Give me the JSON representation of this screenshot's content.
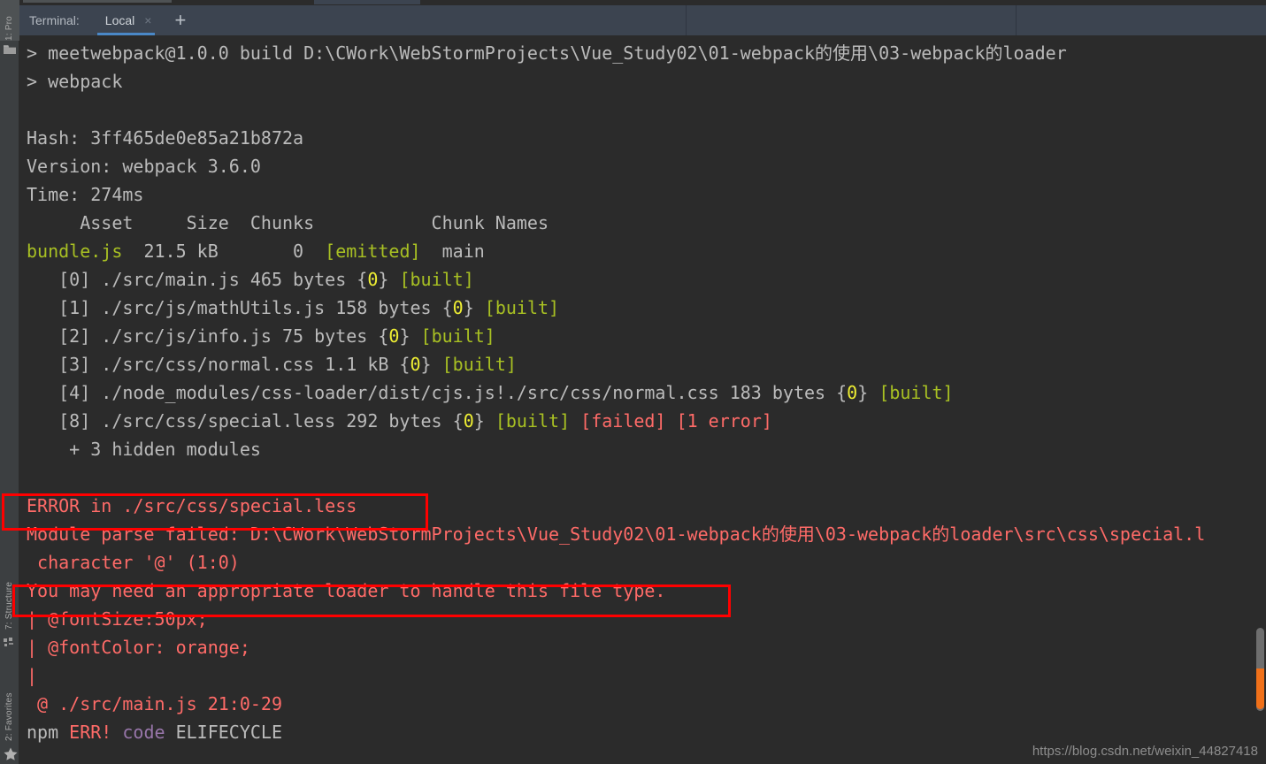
{
  "window": {
    "accent_blue": "#4a88c7",
    "bg": "#2b2b2b",
    "header_bg": "#3c4450",
    "annotation_color": "#ff0000"
  },
  "tool_stripe": {
    "items": [
      {
        "label": "1: Pro",
        "name": "project",
        "icon": "folder-icon"
      },
      {
        "label": "7: Structure",
        "name": "structure",
        "icon": "squares-icon"
      },
      {
        "label": "2: Favorites",
        "name": "favorites",
        "icon": "star-icon"
      }
    ]
  },
  "terminal": {
    "label": "Terminal:",
    "tabs": [
      {
        "label": "Local",
        "close": "×",
        "active": true
      }
    ],
    "new_tab_label": "+"
  },
  "console": {
    "lines": [
      {
        "segs": [
          {
            "t": "> meetwebpack@1.0.0 build D:\\CWork\\WebStormProjects\\Vue_Study02\\01-webpack的使用\\03-webpack的loader",
            "c": "w"
          }
        ]
      },
      {
        "segs": [
          {
            "t": "> webpack",
            "c": "w"
          }
        ]
      },
      {
        "segs": [
          {
            "t": "",
            "c": "w"
          }
        ]
      },
      {
        "segs": [
          {
            "t": "Hash: 3ff465de0e85a21b872a",
            "c": "w"
          }
        ]
      },
      {
        "segs": [
          {
            "t": "Version: webpack 3.6.0",
            "c": "w"
          }
        ]
      },
      {
        "segs": [
          {
            "t": "Time: 274ms",
            "c": "w"
          }
        ]
      },
      {
        "segs": [
          {
            "t": "     Asset     Size  Chunks           Chunk Names",
            "c": "w"
          }
        ]
      },
      {
        "segs": [
          {
            "t": "bundle.js",
            "c": "g"
          },
          {
            "t": "  21.5 kB       0  ",
            "c": "w"
          },
          {
            "t": "[emitted]",
            "c": "g"
          },
          {
            "t": "  main",
            "c": "w"
          }
        ]
      },
      {
        "segs": [
          {
            "t": "   [0] ./src/main.js 465 bytes {",
            "c": "w"
          },
          {
            "t": "0",
            "c": "y"
          },
          {
            "t": "} ",
            "c": "w"
          },
          {
            "t": "[built]",
            "c": "g"
          }
        ]
      },
      {
        "segs": [
          {
            "t": "   [1] ./src/js/mathUtils.js 158 bytes {",
            "c": "w"
          },
          {
            "t": "0",
            "c": "y"
          },
          {
            "t": "} ",
            "c": "w"
          },
          {
            "t": "[built]",
            "c": "g"
          }
        ]
      },
      {
        "segs": [
          {
            "t": "   [2] ./src/js/info.js 75 bytes {",
            "c": "w"
          },
          {
            "t": "0",
            "c": "y"
          },
          {
            "t": "} ",
            "c": "w"
          },
          {
            "t": "[built]",
            "c": "g"
          }
        ]
      },
      {
        "segs": [
          {
            "t": "   [3] ./src/css/normal.css 1.1 kB {",
            "c": "w"
          },
          {
            "t": "0",
            "c": "y"
          },
          {
            "t": "} ",
            "c": "w"
          },
          {
            "t": "[built]",
            "c": "g"
          }
        ]
      },
      {
        "segs": [
          {
            "t": "   [4] ./node_modules/css-loader/dist/cjs.js!./src/css/normal.css 183 bytes {",
            "c": "w"
          },
          {
            "t": "0",
            "c": "y"
          },
          {
            "t": "} ",
            "c": "w"
          },
          {
            "t": "[built]",
            "c": "g"
          }
        ]
      },
      {
        "segs": [
          {
            "t": "   [8] ./src/css/special.less 292 bytes {",
            "c": "w"
          },
          {
            "t": "0",
            "c": "y"
          },
          {
            "t": "} ",
            "c": "w"
          },
          {
            "t": "[built]",
            "c": "g"
          },
          {
            "t": " ",
            "c": "w"
          },
          {
            "t": "[failed]",
            "c": "r"
          },
          {
            "t": " ",
            "c": "w"
          },
          {
            "t": "[1 error]",
            "c": "r"
          }
        ]
      },
      {
        "segs": [
          {
            "t": "    + 3 hidden modules",
            "c": "w"
          }
        ]
      },
      {
        "segs": [
          {
            "t": "",
            "c": "w"
          }
        ]
      },
      {
        "segs": [
          {
            "t": "ERROR in ./src/css/special.less",
            "c": "r"
          }
        ]
      },
      {
        "segs": [
          {
            "t": "Module parse failed: D:\\CWork\\WebStormProjects\\Vue_Study02\\01-webpack的使用\\03-webpack的loader\\src\\css\\special.l",
            "c": "r"
          }
        ]
      },
      {
        "segs": [
          {
            "t": " character '@' (1:0)",
            "c": "r"
          }
        ]
      },
      {
        "segs": [
          {
            "t": "You may need an appropriate loader to handle this file type.",
            "c": "r"
          }
        ]
      },
      {
        "segs": [
          {
            "t": "| @fontSize:50px;",
            "c": "r"
          }
        ]
      },
      {
        "segs": [
          {
            "t": "| @fontColor: orange;",
            "c": "r"
          }
        ]
      },
      {
        "segs": [
          {
            "t": "|",
            "c": "r"
          }
        ]
      },
      {
        "segs": [
          {
            "t": " @ ./src/main.js 21:0-29",
            "c": "r"
          }
        ]
      },
      {
        "segs": [
          {
            "t": "npm ",
            "c": "w"
          },
          {
            "t": "ERR!",
            "c": "r"
          },
          {
            "t": " ",
            "c": "w"
          },
          {
            "t": "code",
            "c": "p"
          },
          {
            "t": " ELIFECYCLE",
            "c": "w"
          }
        ]
      }
    ]
  },
  "annotations": [
    {
      "name": "error-header-highlight",
      "target": "ERROR in ./src/css/special.less"
    },
    {
      "name": "loader-hint-highlight",
      "target": "You may need an appropriate loader to handle this file type."
    }
  ],
  "scrollbar": {
    "thumb_color": "#6e6e6e",
    "error_marker_color": "#f07019"
  },
  "watermark": "https://blog.csdn.net/weixin_44827418"
}
